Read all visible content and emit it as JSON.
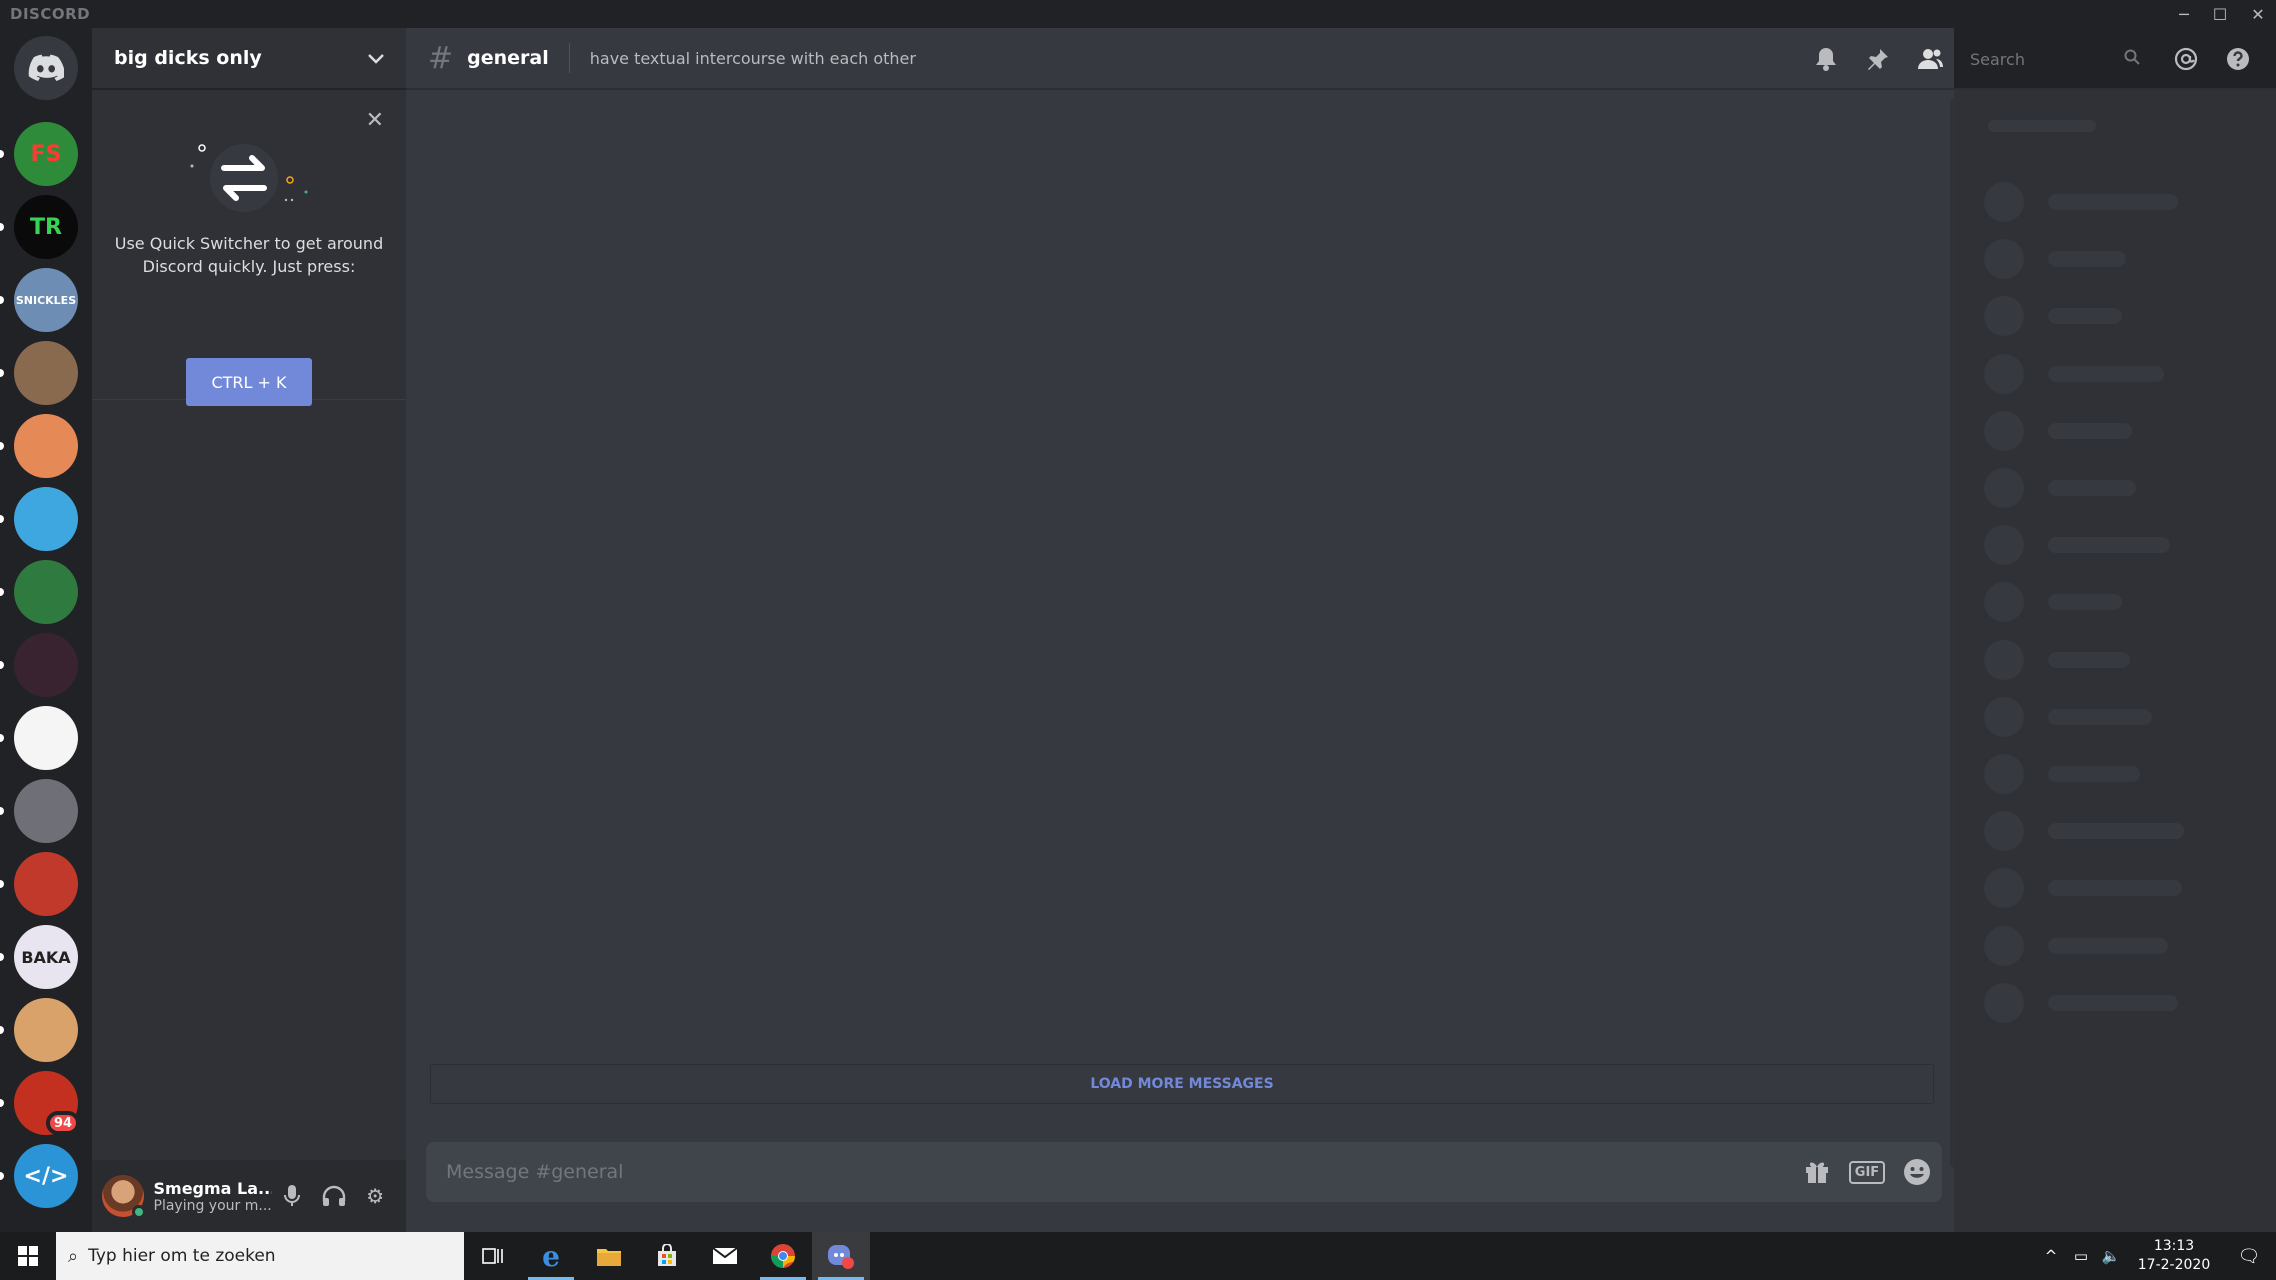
{
  "window": {
    "brand": "DISCORD",
    "minimize_glyph": "─",
    "maximize_glyph": "☐",
    "close_glyph": "✕"
  },
  "guilds": [
    {
      "label": "FS",
      "bg": "#2e8b3a",
      "fg": "#ff3b30",
      "icon": "fs-server-icon"
    },
    {
      "label": "TR",
      "bg": "#0a0a0a",
      "fg": "#39d353",
      "icon": "tr-server-icon"
    },
    {
      "label": "SNICKLES",
      "bg": "#6d8db5",
      "fg": "#ffffff",
      "icon": "snickles-server-icon"
    },
    {
      "label": "",
      "bg": "#8a6a4e",
      "fg": "#ffffff",
      "icon": "bear-server-icon"
    },
    {
      "label": "",
      "bg": "#e58a57",
      "fg": "#ffffff",
      "icon": "fox-server-icon"
    },
    {
      "label": "",
      "bg": "#3fa7e0",
      "fg": "#ffffff",
      "icon": "eye-server-icon"
    },
    {
      "label": "",
      "bg": "#2f7a3e",
      "fg": "#ffffff",
      "icon": "player-server-icon"
    },
    {
      "label": "",
      "bg": "#3a2330",
      "fg": "#ff2d6f",
      "icon": "star-server-icon"
    },
    {
      "label": "",
      "bg": "#f5f5f5",
      "fg": "#111111",
      "icon": "silhouette-server-icon"
    },
    {
      "label": "",
      "bg": "#6f6f78",
      "fg": "#ffffff",
      "icon": "group-server-icon"
    },
    {
      "label": "",
      "bg": "#c0392b",
      "fg": "#ffffff",
      "icon": "face-server-icon"
    },
    {
      "label": "BAKA",
      "bg": "#e8e4f0",
      "fg": "#222222",
      "icon": "baka-server-icon"
    },
    {
      "label": "",
      "bg": "#d8a26a",
      "fg": "#ffffff",
      "icon": "cookie-server-icon"
    },
    {
      "label": "",
      "bg": "#c4301f",
      "fg": "#ffffff",
      "icon": "red-face-server-icon",
      "badge": "94"
    },
    {
      "label": "</>",
      "bg": "#2b94d6",
      "fg": "#ffffff",
      "icon": "code-server-icon"
    }
  ],
  "server": {
    "name": "big dicks only"
  },
  "quick_switcher": {
    "text": "Use Quick Switcher to get around Discord quickly. Just press:",
    "shortcut": "CTRL + K"
  },
  "user": {
    "name": "Smegma La...",
    "status": "Playing your m..."
  },
  "channel": {
    "name": "general",
    "topic": "have textual intercourse with each other"
  },
  "search": {
    "placeholder": "Search"
  },
  "messages": {
    "load_more": "LOAD MORE MESSAGES"
  },
  "composer": {
    "placeholder": "Message #general",
    "gif_label": "GIF"
  },
  "members_placeholder_widths": [
    130,
    78,
    74,
    116,
    84,
    88,
    122,
    74,
    82,
    104,
    92,
    136,
    134,
    120,
    130
  ],
  "taskbar": {
    "search_placeholder": "Typ hier om te zoeken",
    "time": "13:13",
    "date": "17-2-2020"
  },
  "colors": {
    "accent": "#7289da",
    "online": "#43b581",
    "badge": "#f04747"
  }
}
